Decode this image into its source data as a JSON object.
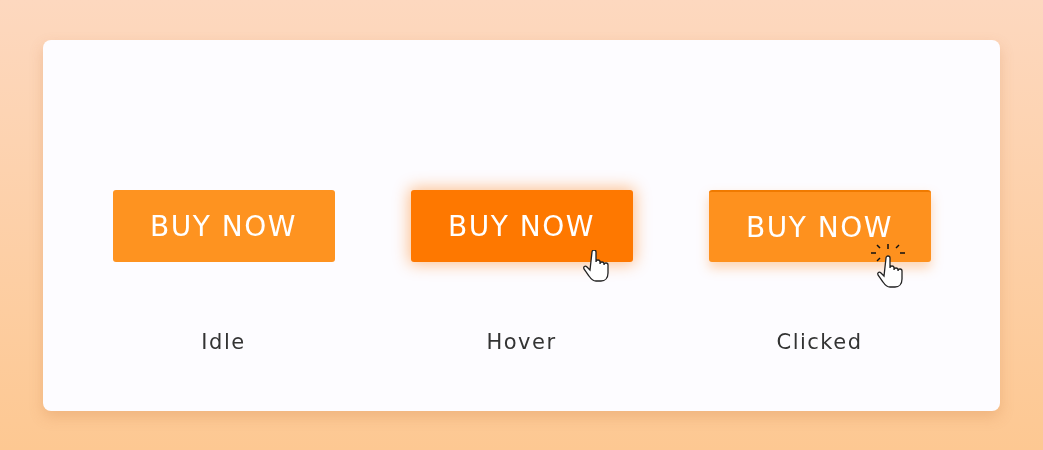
{
  "states": [
    {
      "button": "BUY NOW",
      "caption": "Idle",
      "kind": "idle"
    },
    {
      "button": "BUY NOW",
      "caption": "Hover",
      "kind": "hover"
    },
    {
      "button": "BUY NOW",
      "caption": "Clicked",
      "kind": "clicked"
    }
  ]
}
